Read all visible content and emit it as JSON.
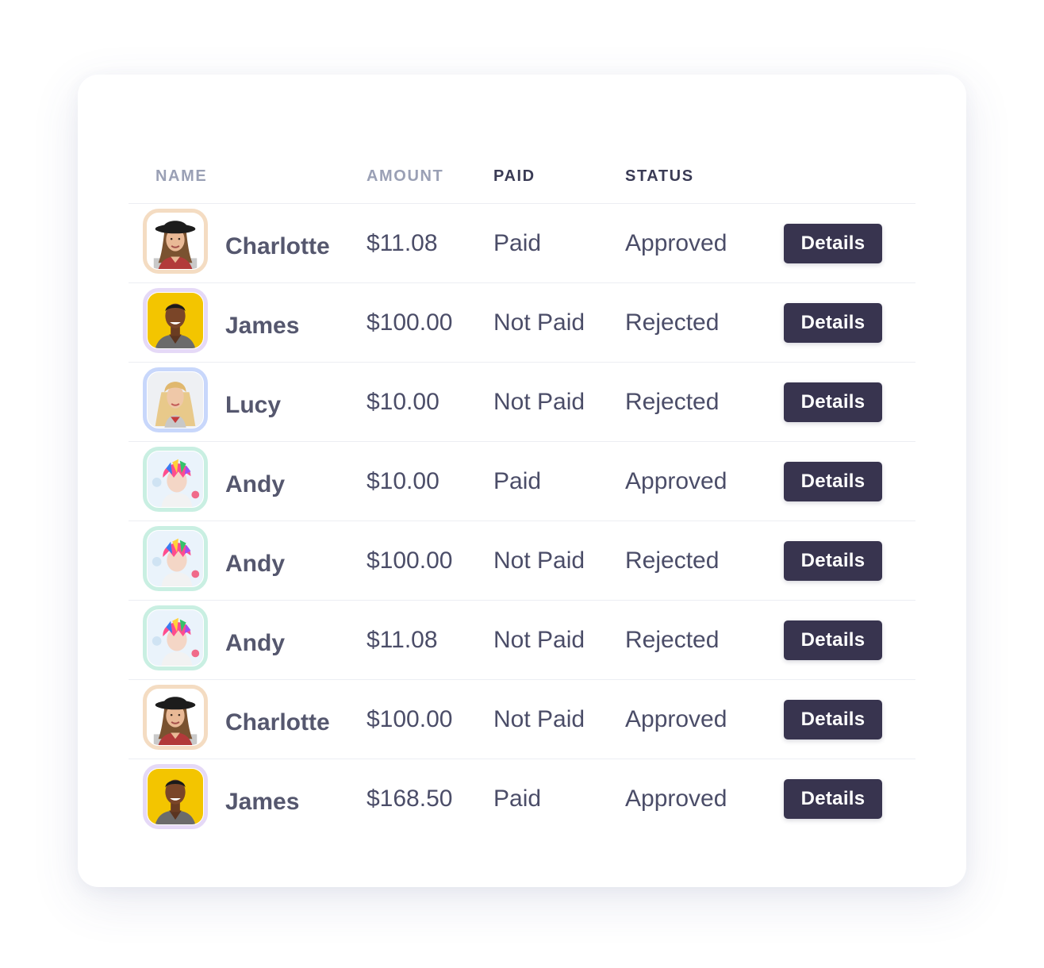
{
  "table": {
    "headers": {
      "name": "NAME",
      "amount": "AMOUNT",
      "paid": "PAID",
      "status": "STATUS"
    },
    "rows": [
      {
        "name": "Charlotte",
        "amount": "$11.08",
        "paid": "Paid",
        "status": "Approved",
        "action": "Details",
        "avatar": "charlotte",
        "avatar_border": "#f4dcc2"
      },
      {
        "name": "James",
        "amount": "$100.00",
        "paid": "Not Paid",
        "status": "Rejected",
        "action": "Details",
        "avatar": "james",
        "avatar_border": "#e5d9f7"
      },
      {
        "name": "Lucy",
        "amount": "$10.00",
        "paid": "Not Paid",
        "status": "Rejected",
        "action": "Details",
        "avatar": "lucy",
        "avatar_border": "#c8d7fb"
      },
      {
        "name": "Andy",
        "amount": "$10.00",
        "paid": "Paid",
        "status": "Approved",
        "action": "Details",
        "avatar": "andy",
        "avatar_border": "#c9efe2"
      },
      {
        "name": "Andy",
        "amount": "$100.00",
        "paid": "Not Paid",
        "status": "Rejected",
        "action": "Details",
        "avatar": "andy",
        "avatar_border": "#c9efe2"
      },
      {
        "name": "Andy",
        "amount": "$11.08",
        "paid": "Not Paid",
        "status": "Rejected",
        "action": "Details",
        "avatar": "andy",
        "avatar_border": "#c9efe2"
      },
      {
        "name": "Charlotte",
        "amount": "$100.00",
        "paid": "Not Paid",
        "status": "Approved",
        "action": "Details",
        "avatar": "charlotte",
        "avatar_border": "#f4dcc2"
      },
      {
        "name": "James",
        "amount": "$168.50",
        "paid": "Paid",
        "status": "Approved",
        "action": "Details",
        "avatar": "james",
        "avatar_border": "#e5d9f7"
      }
    ]
  },
  "colors": {
    "button_bg": "#38344f",
    "header_muted": "#9aa0b5",
    "header_dark": "#3a3b55",
    "text": "#4b4d68"
  }
}
